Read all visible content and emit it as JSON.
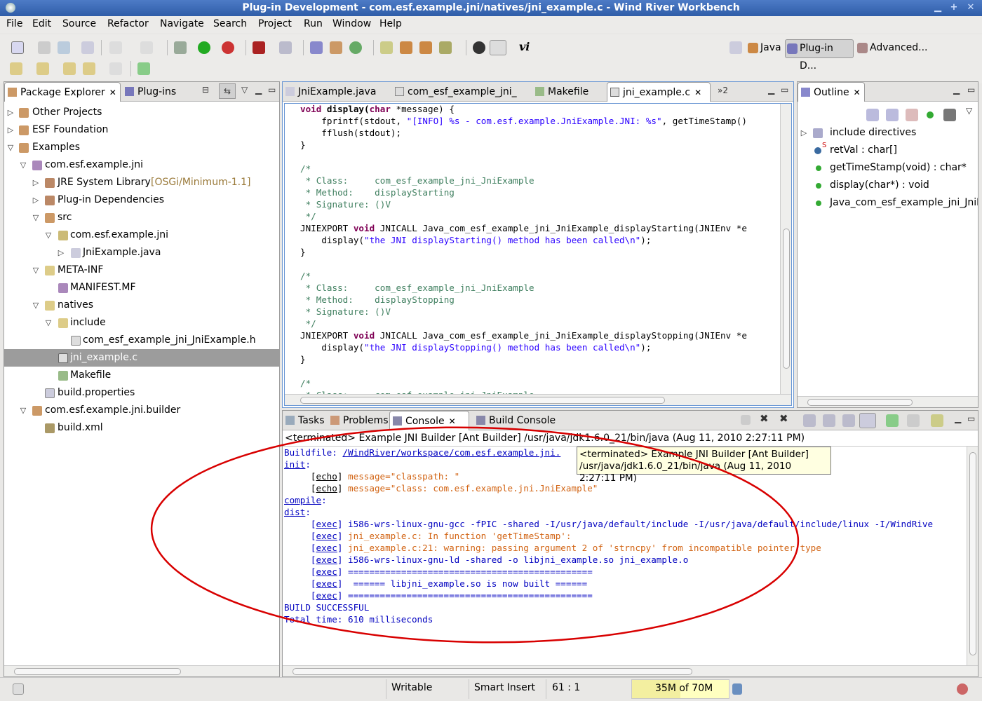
{
  "window": {
    "title": "Plug-in Development - com.esf.example.jni/natives/jni_example.c - Wind River Workbench"
  },
  "menu": [
    "File",
    "Edit",
    "Source",
    "Refactor",
    "Navigate",
    "Search",
    "Project",
    "Run",
    "Window",
    "Help"
  ],
  "perspectives": [
    "Java",
    "Plug-in D...",
    "Advanced..."
  ],
  "vi_label": "vi",
  "package_explorer": {
    "tabs": [
      "Package Explorer",
      "Plug-ins"
    ],
    "tree": [
      {
        "label": "Other Projects"
      },
      {
        "label": "ESF Foundation"
      },
      {
        "label": "Examples"
      },
      {
        "label": "com.esf.example.jni"
      },
      {
        "label": "JRE System Library",
        "suffix": "[OSGi/Minimum-1.1]"
      },
      {
        "label": "Plug-in Dependencies"
      },
      {
        "label": "src"
      },
      {
        "label": "com.esf.example.jni"
      },
      {
        "label": "JniExample.java"
      },
      {
        "label": "META-INF"
      },
      {
        "label": "MANIFEST.MF"
      },
      {
        "label": "natives"
      },
      {
        "label": "include"
      },
      {
        "label": "com_esf_example_jni_JniExample.h"
      },
      {
        "label": "jni_example.c"
      },
      {
        "label": "Makefile"
      },
      {
        "label": "build.properties"
      },
      {
        "label": "com.esf.example.jni.builder"
      },
      {
        "label": "build.xml"
      }
    ]
  },
  "editor": {
    "tabs": [
      "JniExample.java",
      "com_esf_example_jni_",
      "Makefile",
      "jni_example.c"
    ],
    "overflow": "»2",
    "code": {
      "l1a": "void",
      "l1b": " display(",
      "l1c": "char",
      "l1d": " *message) {",
      "l2a": "    fprintf(stdout, ",
      "l2b": "\"[INFO] %s - com.esf.example.JniExample.JNI: %s\"",
      "l2c": ", getTimeStamp()",
      "l3": "    fflush(stdout);",
      "l4": "}",
      "c1": "/*\n * Class:     com_esf_example_jni_JniExample\n * Method:    displayStarting\n * Signature: ()V\n */",
      "l10a": "JNIEXPORT ",
      "l10b": "void",
      "l10c": " JNICALL Java_com_esf_example_jni_JniExample_displayStarting(JNIEnv *e",
      "l11a": "    display(",
      "l11b": "\"the JNI displayStarting() method has been called\\n\"",
      "l11c": ");",
      "l12": "}",
      "c2": "/*\n * Class:     com_esf_example_jni_JniExample\n * Method:    displayStopping\n * Signature: ()V\n */",
      "l19a": "JNIEXPORT ",
      "l19b": "void",
      "l19c": " JNICALL Java_com_esf_example_jni_JniExample_displayStopping(JNIEnv *e",
      "l20a": "    display(",
      "l20b": "\"the JNI displayStopping() method has been called\\n\"",
      "l20c": ");",
      "l21": "}",
      "c3": "/*\n * Class:     com_esf_example_jni_JniExample"
    }
  },
  "outline": {
    "tab": "Outline",
    "items": [
      "include directives",
      "retVal : char[]",
      "getTimeStamp(void) : char*",
      "display(char*) : void",
      "Java_com_esf_example_jni_JniE"
    ],
    "static_marker": "S"
  },
  "console": {
    "tabs": [
      "Tasks",
      "Problems",
      "Console",
      "Build Console"
    ],
    "header": "<terminated> Example JNI Builder [Ant Builder] /usr/java/jdk1.6.0_21/bin/java (Aug 11, 2010 2:27:11 PM)",
    "buildfile_label": "Buildfile: ",
    "buildfile_path": "/WindRiver/workspace/com.esf.example.jni.",
    "init": "init",
    "colon": ":",
    "echo_tag": "[echo]",
    "exec_tag": "[exec]",
    "echo1": " message=\"classpath: \"",
    "echo2": " message=\"class: com.esf.example.jni.JniExample\"",
    "compile": "compile",
    "dist": "dist",
    "exec1": " i586-wrs-linux-gnu-gcc -fPIC -shared -I/usr/java/default/include -I/usr/java/default/include/linux -I/WindRive",
    "exec2": " jni_example.c: In function 'getTimeStamp':",
    "exec3": " jni_example.c:21: warning: passing argument 2 of 'strncpy' from incompatible pointer type",
    "exec4": " i586-wrs-linux-gnu-ld -shared -o libjni_example.so jni_example.o",
    "exec5": " ==============================================",
    "exec6": "  ====== libjni_example.so is now built ======",
    "exec7": " ==============================================",
    "success": "BUILD SUCCESSFUL",
    "total": "Total time: 610 milliseconds",
    "tooltip": "<terminated> Example JNI Builder [Ant Builder] /usr/java/jdk1.6.0_21/bin/java (Aug 11, 2010 2:27:11 PM)"
  },
  "status": {
    "writable": "Writable",
    "insert": "Smart Insert",
    "position": "61 : 1",
    "memory": "35M of 70M"
  },
  "colors": {
    "annotation": "#d80000",
    "title_bar": "#3a68b4",
    "selection": "#9c9c9c"
  }
}
